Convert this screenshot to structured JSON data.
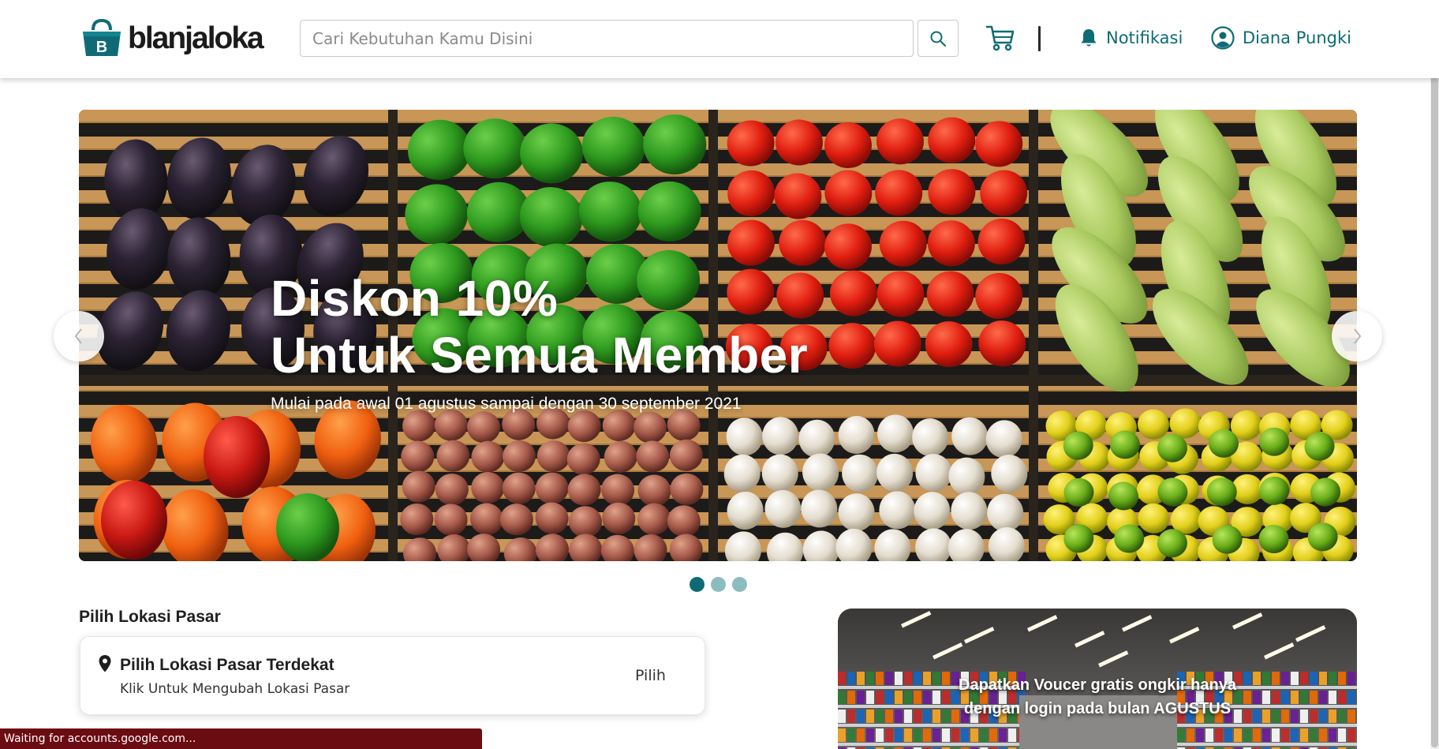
{
  "header": {
    "logo_text": "blanjaloka",
    "logo_letter": "B",
    "search_placeholder": "Cari Kebutuhan Kamu Disini",
    "notifications_label": "Notifikasi",
    "user_name": "Diana Pungki"
  },
  "banner": {
    "headline_line1": "Diskon 10%",
    "headline_line2": "Untuk Semua Member",
    "subline": "Mulai pada awal 01 agustus sampai dengan 30 september 2021",
    "slides_total": 3,
    "active_slide": 1
  },
  "market": {
    "section_title": "Pilih Lokasi Pasar",
    "card_title": "Pilih Lokasi Pasar Terdekat",
    "card_subtitle": "Klik Untuk Mengubah Lokasi Pasar",
    "action_label": "Pilih"
  },
  "voucher": {
    "text": "Dapatkan Voucer gratis ongkir hanya dengan login pada bulan AGUSTUS"
  },
  "status_bar": {
    "text": "Waiting for accounts.google.com..."
  },
  "colors": {
    "brand_teal": "#0e6b76",
    "dot_inactive": "#8dbcc0",
    "status_bar_bg": "#6b0c12"
  },
  "icons": {
    "logo": "shopping-bag-icon",
    "search": "search-icon",
    "cart": "cart-icon",
    "notifications": "bell-icon",
    "user": "user-circle-icon",
    "location": "map-pin-icon",
    "prev": "chevron-left-icon",
    "next": "chevron-right-icon"
  }
}
